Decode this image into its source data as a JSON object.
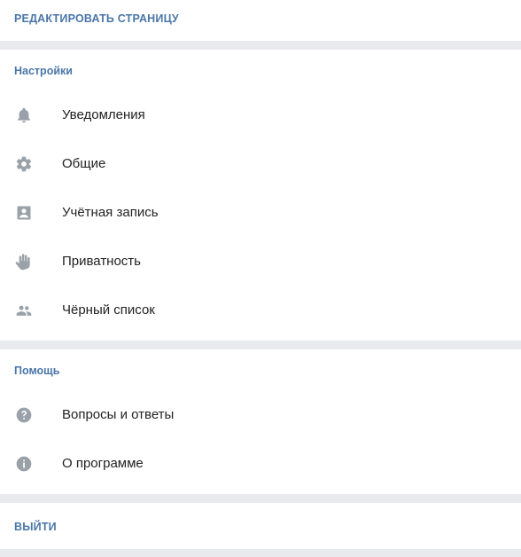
{
  "edit_page": {
    "label": "РЕДАКТИРОВАТЬ СТРАНИЦУ"
  },
  "settings": {
    "title": "Настройки",
    "items": [
      {
        "label": "Уведомления",
        "icon": "bell-icon"
      },
      {
        "label": "Общие",
        "icon": "gear-icon"
      },
      {
        "label": "Учётная запись",
        "icon": "account-icon"
      },
      {
        "label": "Приватность",
        "icon": "hand-icon"
      },
      {
        "label": "Чёрный список",
        "icon": "people-icon"
      }
    ]
  },
  "help": {
    "title": "Помощь",
    "items": [
      {
        "label": "Вопросы и ответы",
        "icon": "question-icon"
      },
      {
        "label": "О программе",
        "icon": "info-icon"
      }
    ]
  },
  "logout": {
    "label": "ВЫЙТИ"
  },
  "colors": {
    "accent": "#4a76a8",
    "icon": "#9aa1a9",
    "text": "#222222",
    "background": "#e8eaed"
  }
}
